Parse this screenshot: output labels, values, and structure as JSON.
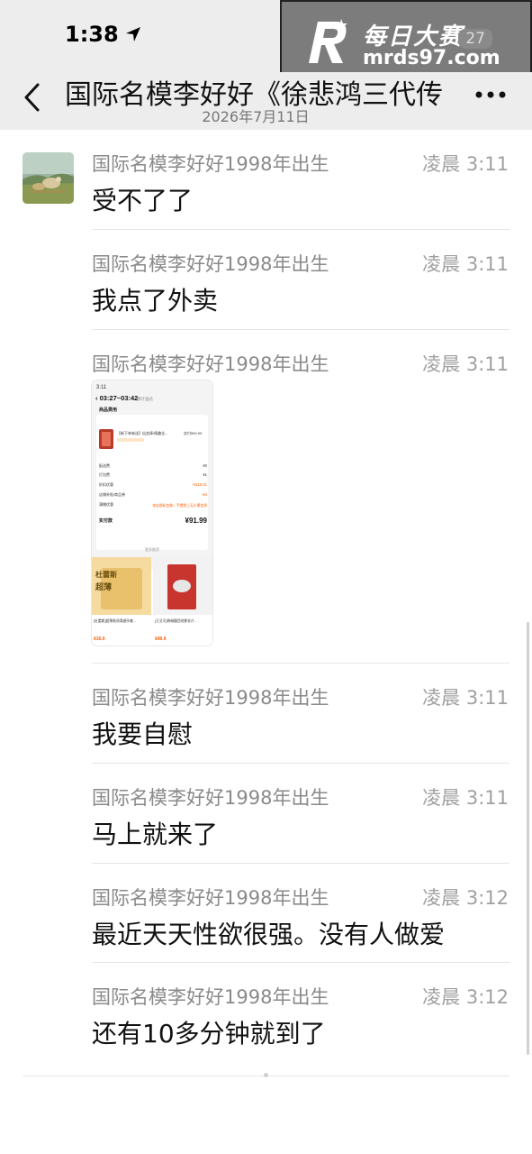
{
  "status_bar": {
    "time": "1:38"
  },
  "watermark": {
    "site_name": "每日大赛",
    "url": "mrds97.com",
    "badge": "27"
  },
  "header": {
    "title": "国际名模李好好《徐悲鸿三代传",
    "date": "2026年7月11日"
  },
  "messages": [
    {
      "sender": "国际名模李好好1998年出生",
      "time": "凌晨 3:11",
      "text": "受不了了"
    },
    {
      "sender": "国际名模李好好1998年出生",
      "time": "凌晨 3:11",
      "text": "我点了外卖"
    },
    {
      "sender": "国际名模李好好1998年出生",
      "time": "凌晨 3:11",
      "text": ""
    },
    {
      "sender": "国际名模李好好1998年出生",
      "time": "凌晨 3:11",
      "text": "我要自慰"
    },
    {
      "sender": "国际名模李好好1998年出生",
      "time": "凌晨 3:11",
      "text": "马上就来了"
    },
    {
      "sender": "国际名模李好好1998年出生",
      "time": "凌晨 3:12",
      "text": "最近天天性欲很强。没有人做爱"
    },
    {
      "sender": "国际名模李好好1998年出生",
      "time": "凌晨 3:12",
      "text": "还有10多分钟就到了"
    }
  ],
  "image_message": {
    "screen_time": "3:11",
    "eta": "03:27~03:42",
    "eta_suffix": "预计送达",
    "section": "商品费用",
    "product_name": "【新下单来送】仙女棒/情趣全...",
    "product_price": "实付¥90.99",
    "fees": [
      {
        "label": "配送费",
        "value": "¥0"
      },
      {
        "label": "打包费",
        "value": "¥1"
      },
      {
        "label": "折扣优惠",
        "value": "-¥110.01"
      },
      {
        "label": "店铺补贴/商品券",
        "value": "-¥4"
      },
      {
        "label": "满赠优惠",
        "value": "本店隐私包装丨手提袋上无小票信息"
      }
    ],
    "total_label": "实付款",
    "total_value": "¥91.99",
    "more_label": "更多推荐",
    "rec1_brand": "杜蕾斯",
    "rec1_title": "超薄",
    "rec1_desc": "[杜蕾斯]超薄装润滑避孕套...",
    "rec1_price": "¥16.9",
    "rec2_desc": "[万艾可]枸橼酸西地那非片...",
    "rec2_price": "¥49.9",
    "colors": {
      "accent": "#ff5a00",
      "panel": "#f6dba0"
    }
  }
}
